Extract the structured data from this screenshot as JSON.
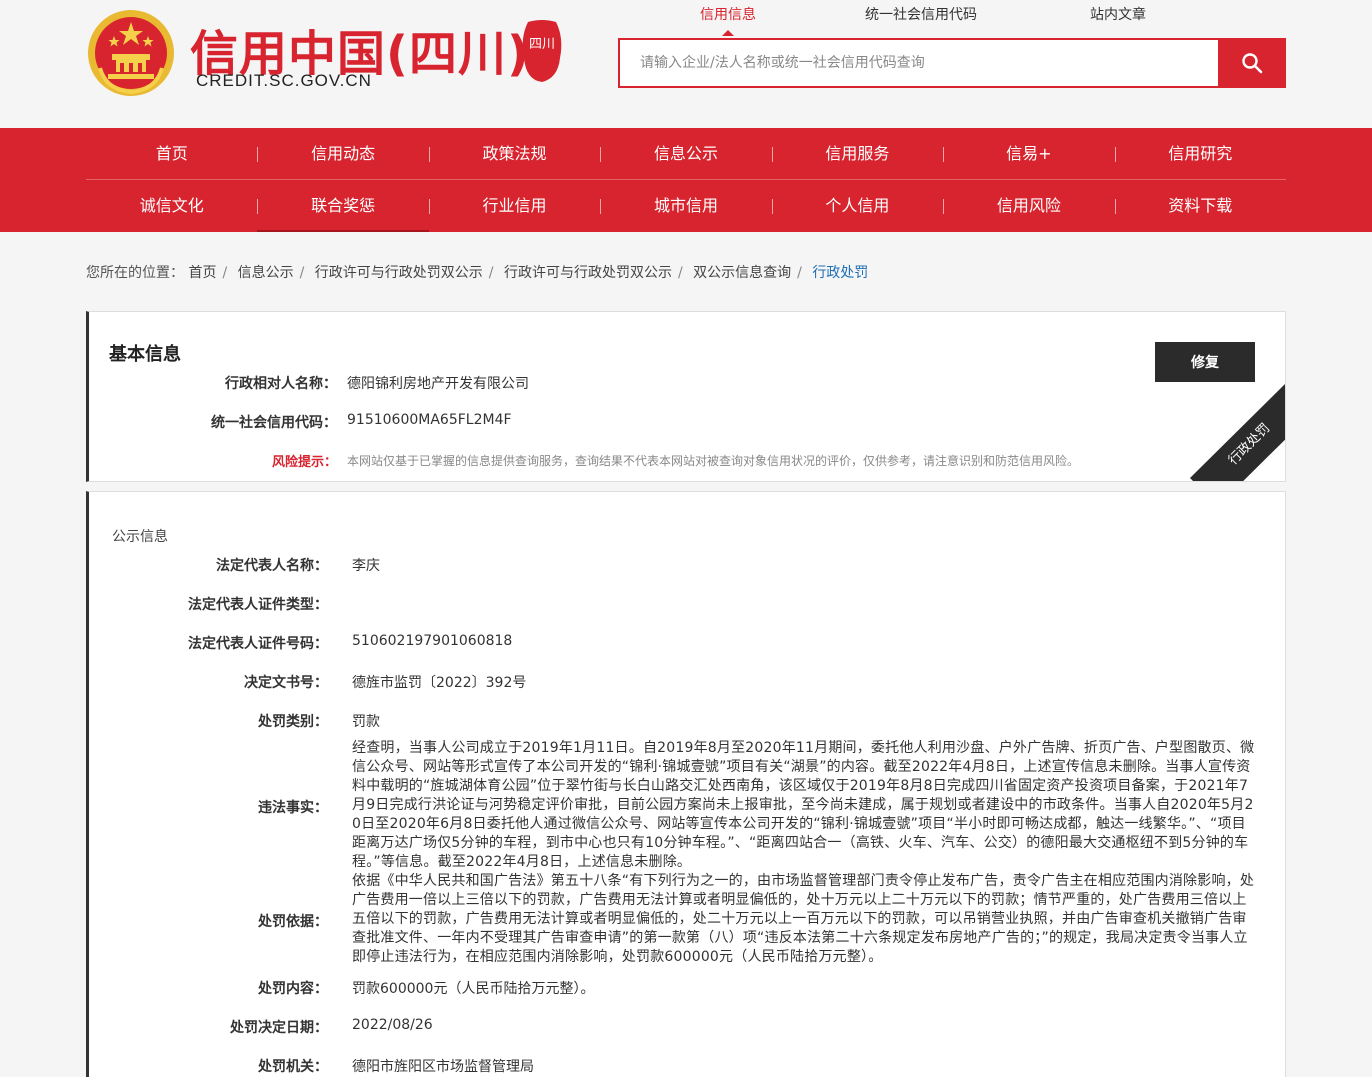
{
  "header": {
    "site_title": "信用中国(四川)",
    "site_domain": "CREDIT.SC.GOV.CN",
    "seal_text": "四川",
    "search_tabs": [
      "信用信息",
      "统一社会信用代码",
      "站内文章"
    ],
    "search_placeholder": "请输入企业/法人名称或统一社会信用代码查询"
  },
  "nav": {
    "row1": [
      "首页",
      "信用动态",
      "政策法规",
      "信息公示",
      "信用服务",
      "信易+",
      "信用研究"
    ],
    "row2": [
      "诚信文化",
      "联合奖惩",
      "行业信用",
      "城市信用",
      "个人信用",
      "信用风险",
      "资料下载"
    ]
  },
  "breadcrumb": {
    "prefix": "您所在的位置：",
    "items": [
      "首页",
      "信息公示",
      "行政许可与行政处罚双公示",
      "行政许可与行政处罚双公示",
      "双公示信息查询",
      "行政处罚"
    ]
  },
  "basic": {
    "title": "基本信息",
    "name_label": "行政相对人名称：",
    "name_value": "德阳锦利房地产开发有限公司",
    "code_label": "统一社会信用代码：",
    "code_value": "91510600MA65FL2M4F",
    "risk_label": "风险提示：",
    "risk_text": "本网站仅基于已掌握的信息提供查询服务，查询结果不代表本网站对被查询对象信用状况的评价，仅供参考，请注意识别和防范信用风险。",
    "repair_button": "修复",
    "ribbon_text": "行政处罚"
  },
  "public": {
    "title": "公示信息",
    "rows": [
      {
        "label": "法定代表人名称：",
        "value": "李庆"
      },
      {
        "label": "法定代表人证件类型：",
        "value": ""
      },
      {
        "label": "法定代表人证件号码：",
        "value": "510602197901060818"
      },
      {
        "label": "决定文书号：",
        "value": "德旌市监罚〔2022〕392号"
      },
      {
        "label": "处罚类别：",
        "value": "罚款"
      },
      {
        "label": "违法事实：",
        "value": "经查明，当事人公司成立于2019年1月11日。自2019年8月至2020年11月期间，委托他人利用沙盘、户外广告牌、折页广告、户型图散页、微信公众号、网站等形式宣传了本公司开发的“锦利·锦城壹號”项目有关“湖景”的内容。截至2022年4月8日，上述宣传信息未删除。当事人宣传资料中载明的“旌城湖体育公园”位于翠竹街与长白山路交汇处西南角，该区域仅于2019年8月8日完成四川省固定资产投资项目备案，于2021年7月9日完成行洪论证与河势稳定评价审批，目前公园方案尚未上报审批，至今尚未建成，属于规划或者建设中的市政条件。当事人自2020年5月20日至2020年6月8日委托他人通过微信公众号、网站等宣传本公司开发的“锦利·锦城壹號”项目“半小时即可畅达成都，触达一线繁华。”、“项目距离万达广场仅5分钟的车程，到市中心也只有10分钟车程。”、“距离四站合一（高铁、火车、汽车、公交）的德阳最大交通枢纽不到5分钟的车程。”等信息。截至2022年4月8日，上述信息未删除。"
      },
      {
        "label": "处罚依据：",
        "value": "依据《中华人民共和国广告法》第五十八条“有下列行为之一的，由市场监督管理部门责令停止发布广告，责令广告主在相应范围内消除影响，处广告费用一倍以上三倍以下的罚款，广告费用无法计算或者明显偏低的，处十万元以上二十万元以下的罚款；情节严重的，处广告费用三倍以上五倍以下的罚款，广告费用无法计算或者明显偏低的，处二十万元以上一百万元以下的罚款，可以吊销营业执照，并由广告审查机关撤销广告审查批准文件、一年内不受理其广告审查申请”的第一款第（八）项“违反本法第二十六条规定发布房地产广告的；”的规定，我局决定责令当事人立即停止违法行为，在相应范围内消除影响，处罚款600000元（人民币陆拾万元整）。"
      },
      {
        "label": "处罚内容：",
        "value": "罚款600000元（人民币陆拾万元整）。"
      },
      {
        "label": "处罚决定日期：",
        "value": "2022/08/26"
      },
      {
        "label": "处罚机关：",
        "value": "德阳市旌阳区市场监督管理局"
      }
    ]
  },
  "colors": {
    "brand_red": "#d7242f",
    "dark": "#2b2b2b",
    "link_blue": "#1f6fb5"
  }
}
